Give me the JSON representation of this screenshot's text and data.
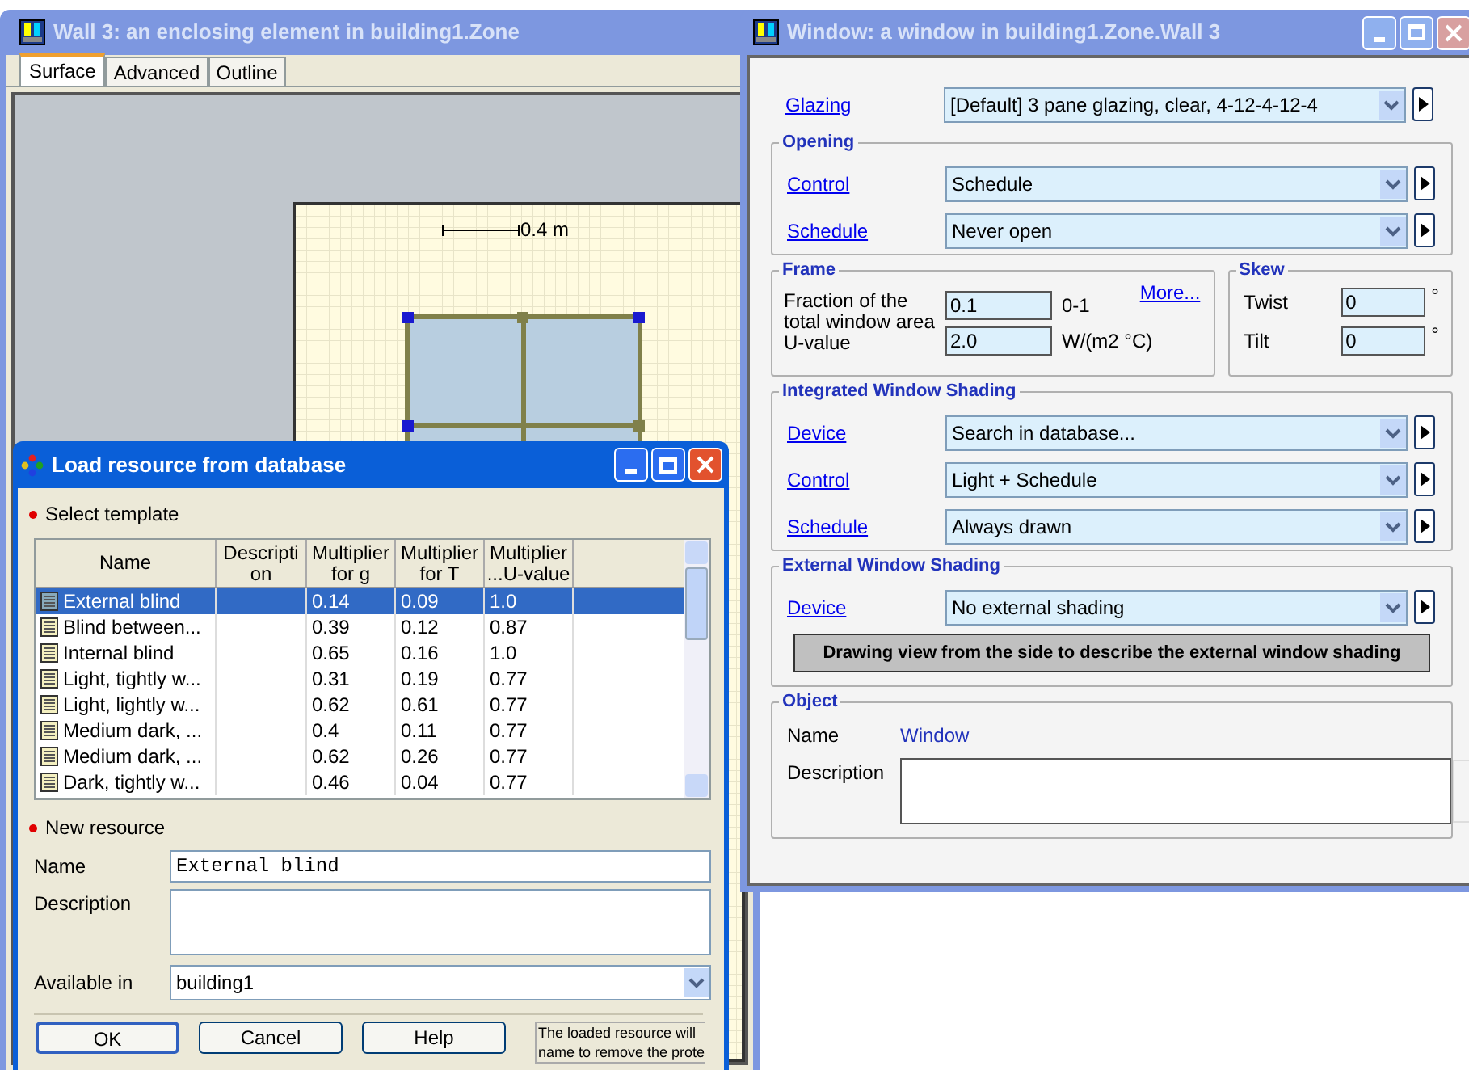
{
  "wall_window": {
    "title": "Wall 3: an enclosing element in building1.Zone",
    "tabs": [
      {
        "label": "Surface",
        "selected": true
      },
      {
        "label": "Advanced",
        "selected": false
      },
      {
        "label": "Outline",
        "selected": false
      }
    ],
    "scale_label": "0.4 m"
  },
  "window_dialog": {
    "title": "Window: a window in building1.Zone.Wall 3",
    "glazing": {
      "label": "Glazing",
      "value": "[Default] 3 pane glazing, clear, 4-12-4-12-4"
    },
    "opening": {
      "title": "Opening",
      "rows": [
        {
          "label": "Control",
          "value": "Schedule"
        },
        {
          "label": "Schedule",
          "value": "Never open"
        }
      ]
    },
    "frame": {
      "title": "Frame",
      "more": "More...",
      "fraction_label": "Fraction of the total window area",
      "fraction_value": "0.1",
      "fraction_unit": "0-1",
      "uvalue_label": "U-value",
      "uvalue_value": "2.0",
      "uvalue_unit": "W/(m2 °C)"
    },
    "skew": {
      "title": "Skew",
      "rows": [
        {
          "label": "Twist",
          "value": "0",
          "unit": "°"
        },
        {
          "label": "Tilt",
          "value": "0",
          "unit": "°"
        }
      ]
    },
    "integrated": {
      "title": "Integrated Window Shading",
      "rows": [
        {
          "label": "Device",
          "value": "Search in database..."
        },
        {
          "label": "Control",
          "value": "Light + Schedule"
        },
        {
          "label": "Schedule",
          "value": "Always drawn"
        }
      ]
    },
    "external": {
      "title": "External Window Shading",
      "rows": [
        {
          "label": "Device",
          "value": "No external shading"
        }
      ],
      "drawing_button": "Drawing view from the side to describe the external window shading"
    },
    "object": {
      "title": "Object",
      "name_label": "Name",
      "name_value": "Window",
      "description_label": "Description"
    }
  },
  "load_dialog": {
    "title": "Load resource from database",
    "select_heading": "Select template",
    "columns": [
      "Name",
      "Descripti on",
      "Multiplier for g",
      "Multiplier for T",
      "Multiplier ...U-value"
    ],
    "rows": [
      {
        "cells": [
          "External blind",
          "",
          "0.14",
          "0.09",
          "1.0"
        ],
        "selected": true
      },
      {
        "cells": [
          "Blind between...",
          "",
          "0.39",
          "0.12",
          "0.87"
        ],
        "selected": false
      },
      {
        "cells": [
          "Internal blind",
          "",
          "0.65",
          "0.16",
          "1.0"
        ],
        "selected": false
      },
      {
        "cells": [
          "Light, tightly w...",
          "",
          "0.31",
          "0.19",
          "0.77"
        ],
        "selected": false
      },
      {
        "cells": [
          "Light, lightly w...",
          "",
          "0.62",
          "0.61",
          "0.77"
        ],
        "selected": false
      },
      {
        "cells": [
          "Medium dark, ...",
          "",
          "0.4",
          "0.11",
          "0.77"
        ],
        "selected": false
      },
      {
        "cells": [
          "Medium dark, ...",
          "",
          "0.62",
          "0.26",
          "0.77"
        ],
        "selected": false
      },
      {
        "cells": [
          "Dark, tightly w...",
          "",
          "0.46",
          "0.04",
          "0.77"
        ],
        "selected": false
      }
    ],
    "new_heading": "New resource",
    "name_label": "Name",
    "name_value": "External blind",
    "description_label": "Description",
    "available_label": "Available in",
    "available_value": "building1",
    "buttons": [
      "OK",
      "Cancel",
      "Help"
    ],
    "note_lines": [
      "The loaded resource will",
      "name to remove the prote"
    ]
  }
}
